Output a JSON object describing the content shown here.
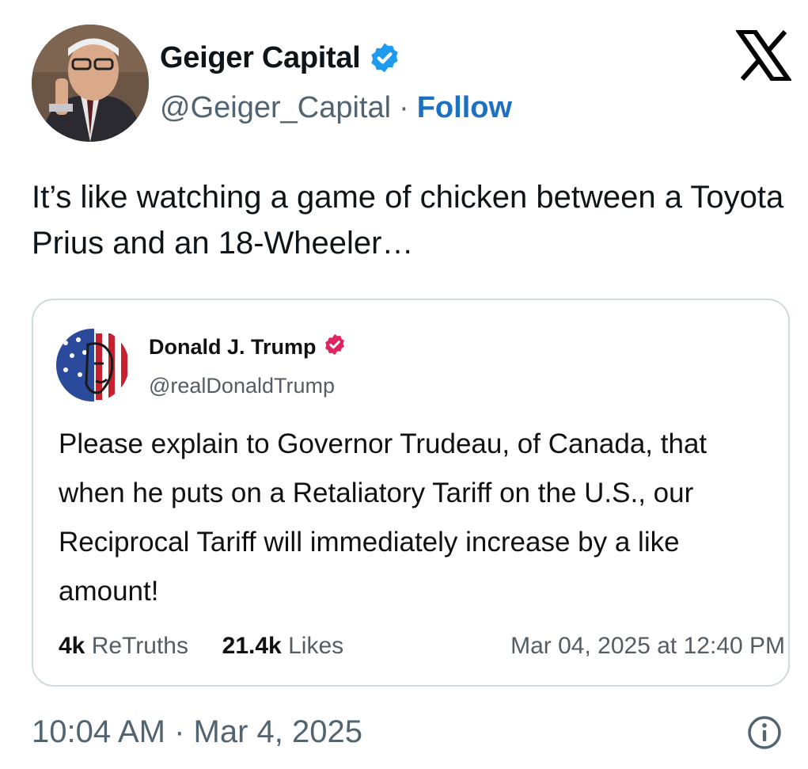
{
  "author": {
    "display_name": "Geiger Capital",
    "handle": "@Geiger_Capital",
    "separator": "·",
    "follow_label": "Follow",
    "verified_color": "#1d9bf0"
  },
  "tweet": {
    "text": "It’s like watching a game of chicken between a Toyota Prius and an 18-Wheeler…",
    "time": "10:04 AM · Mar 4, 2025"
  },
  "quoted_post": {
    "display_name": "Donald J. Trump",
    "handle": "@realDonaldTrump",
    "verified_color": "#e0245e",
    "text": "Please explain to Governor Trudeau, of Canada, that when he puts on a Retaliatory Tariff on the U.S., our Reciprocal Tariff will immediately increase by a like amount!",
    "retruths_count": "4k",
    "retruths_label": "ReTruths",
    "likes_count": "21.4k",
    "likes_label": "Likes",
    "date": "Mar 04, 2025 at 12:40 PM"
  },
  "icons": {
    "brand": "x-logo-icon",
    "verified": "verified-badge-icon",
    "info": "info-icon"
  }
}
